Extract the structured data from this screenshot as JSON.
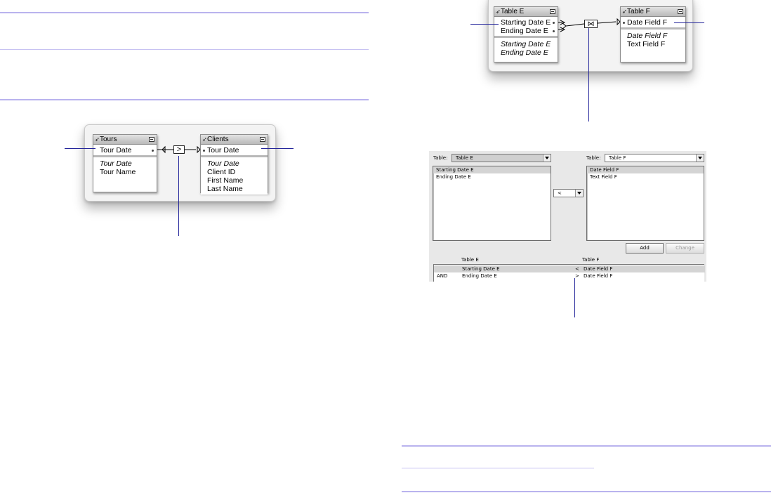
{
  "tours_graph": {
    "left_table": {
      "name": "Tours",
      "key_fields": [
        "Tour Date"
      ],
      "fields": [
        "Tour Date",
        "Tour Name"
      ],
      "italic_fields": [
        0
      ]
    },
    "right_table": {
      "name": "Clients",
      "key_fields": [
        "Tour Date"
      ],
      "fields": [
        "Tour Date",
        "Client ID",
        "First Name",
        "Last Name"
      ],
      "italic_fields": [
        0
      ]
    },
    "operator": ">"
  },
  "tables_graph": {
    "left_table": {
      "name": "Table E",
      "key_fields": [
        "Starting Date E",
        "Ending Date E"
      ],
      "fields": [
        "Starting Date E",
        "Ending Date E"
      ],
      "italic_fields": [
        0,
        1
      ]
    },
    "right_table": {
      "name": "Table F",
      "key_fields": [
        "Date Field F"
      ],
      "fields": [
        "Date Field F",
        "Text Field F"
      ],
      "italic_fields": [
        0
      ]
    },
    "operator": "⋈"
  },
  "dialog": {
    "left_table_label": "Table:",
    "left_table_value": "Table E",
    "right_table_label": "Table:",
    "right_table_value": "Table F",
    "left_fields": [
      "Starting Date E",
      "Ending Date E"
    ],
    "left_selected": 0,
    "right_fields": [
      "Date Field F",
      "Text Field F"
    ],
    "right_selected": 0,
    "operator_value": "<",
    "add_button": "Add",
    "change_button": "Change",
    "grid_headers": {
      "left": "Table E",
      "right": "Table F"
    },
    "criteria": [
      {
        "logic": "",
        "left_field": "Starting Date E",
        "op": "<",
        "right_field": "Date Field F"
      },
      {
        "logic": "AND",
        "left_field": "Ending Date E",
        "op": ">",
        "right_field": "Date Field F"
      }
    ]
  },
  "colors": {
    "rule": "#b9b3ee",
    "callout": "#23249a",
    "selection": "#d4d4d4"
  }
}
